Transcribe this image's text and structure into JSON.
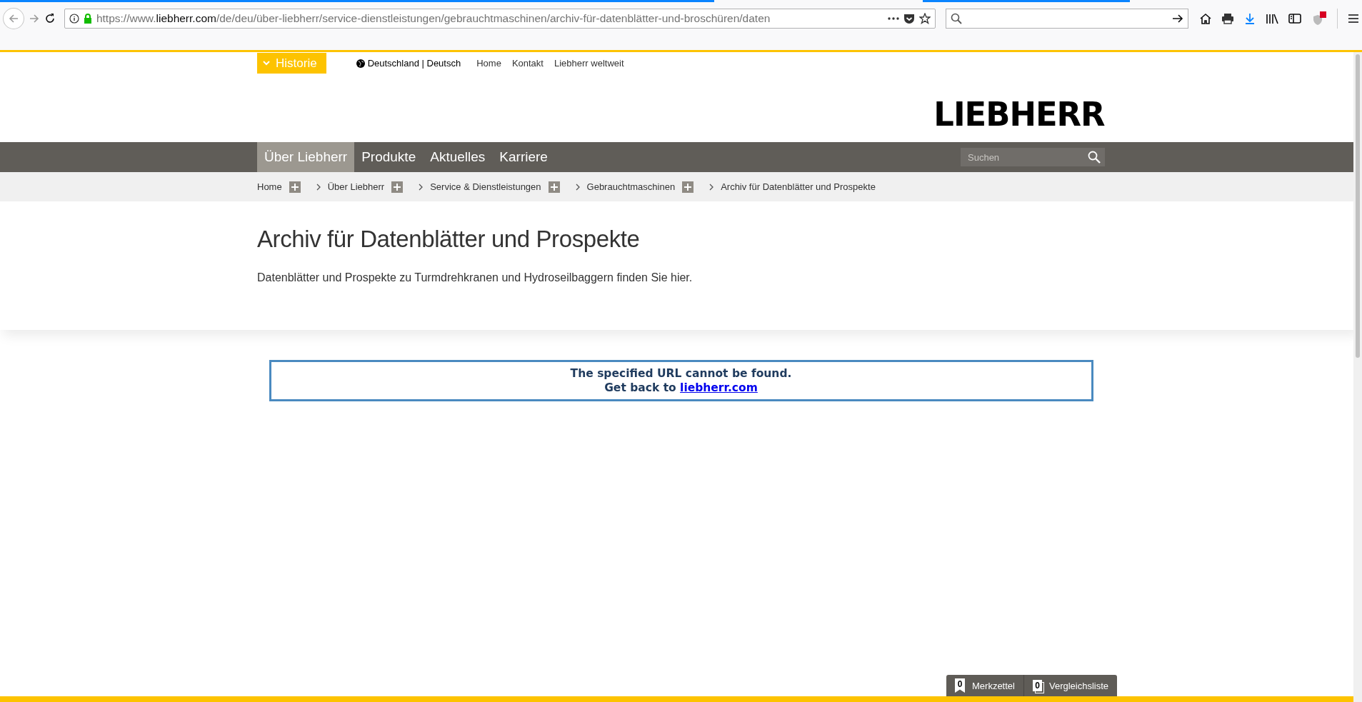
{
  "browser": {
    "url": "https://www.**liebherr.com**/de/deu/über-liebherr/service-dienstleistungen/gebrauchtmaschinen/archiv-für-datenblätter-und-broschüren/daten"
  },
  "header": {
    "history_button": "Historie",
    "region": "Deutschland | Deutsch",
    "links": [
      "Home",
      "Kontakt",
      "Liebherr weltweit"
    ],
    "logo": "LIEBHERR"
  },
  "nav": {
    "items": [
      {
        "label": "Über Liebherr",
        "selected": true
      },
      {
        "label": "Produkte",
        "selected": false
      },
      {
        "label": "Aktuelles",
        "selected": false
      },
      {
        "label": "Karriere",
        "selected": false
      }
    ],
    "search": {
      "placeholder": "Suchen"
    }
  },
  "breadcrumbs": [
    {
      "label": "Home",
      "expandable": true
    },
    {
      "label": "Über Liebherr",
      "expandable": true
    },
    {
      "label": "Service & Dienstleistungen",
      "expandable": true
    },
    {
      "label": "Gebrauchtmaschinen",
      "expandable": true
    },
    {
      "label": "Archiv für Datenblätter und Prospekte",
      "expandable": false
    }
  ],
  "intro": {
    "title": "Archiv für Datenblätter und Prospekte",
    "text": "Datenblätter und Prospekte zu Turmdrehkranen und Hydroseilbaggern finden Sie hier."
  },
  "error": {
    "message": "The specified URL cannot be found.",
    "back_text": "Get back to",
    "back_link": "liebherr.com"
  },
  "bottom_tabs": [
    {
      "kind": "notepad",
      "count": "0",
      "label": "Merkzettel"
    },
    {
      "kind": "compare",
      "count": "0",
      "label": "Vergleichsliste"
    }
  ]
}
